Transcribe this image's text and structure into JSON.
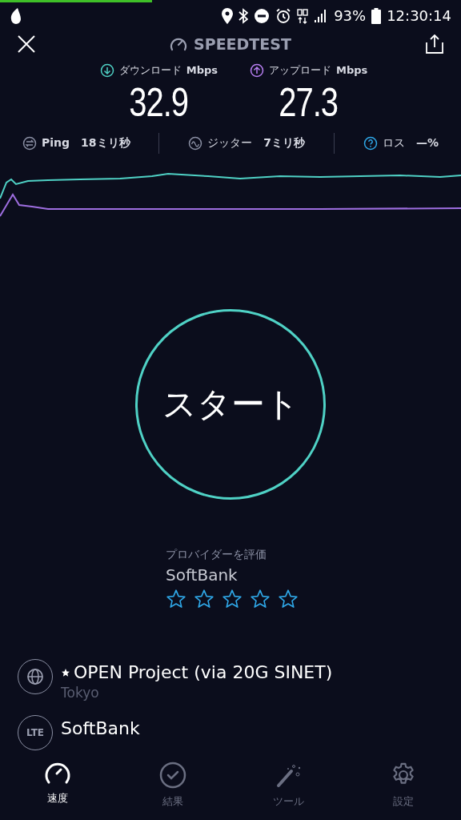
{
  "status_bar": {
    "battery": "93%",
    "time": "12:30:14"
  },
  "header": {
    "title": "SPEEDTEST"
  },
  "results": [
    {
      "kind": "download",
      "label": "ダウンロード",
      "unit": "Mbps",
      "value": "32.9"
    },
    {
      "kind": "upload",
      "label": "アップロード",
      "unit": "Mbps",
      "value": "27.3"
    }
  ],
  "metrics": [
    {
      "kind": "ping",
      "label": "Ping",
      "value": "18ミリ秒"
    },
    {
      "kind": "jitter",
      "label": "ジッター",
      "value": "7ミリ秒"
    },
    {
      "kind": "loss",
      "label": "ロス",
      "value": "—%"
    }
  ],
  "start_button": {
    "label": "スタート"
  },
  "rating": {
    "prompt": "プロバイダーを評価",
    "provider": "SoftBank",
    "stars": 0
  },
  "connections": [
    {
      "kind": "server",
      "name": "OPEN Project (via 20G SINET)",
      "starred": true,
      "location": "Tokyo"
    },
    {
      "kind": "lte",
      "name": "SoftBank",
      "badge": "LTE"
    }
  ],
  "tabs": [
    {
      "kind": "speed",
      "label": "速度",
      "selected": true
    },
    {
      "kind": "results",
      "label": "結果",
      "selected": false
    },
    {
      "kind": "tools",
      "label": "ツール",
      "selected": false
    },
    {
      "kind": "settings",
      "label": "設定",
      "selected": false
    }
  ]
}
